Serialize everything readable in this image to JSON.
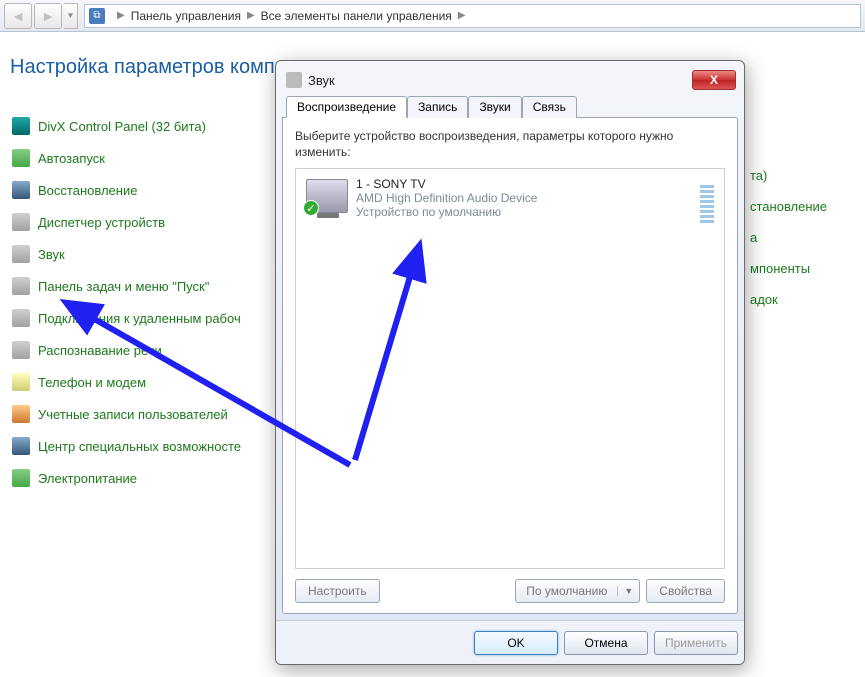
{
  "breadcrumb": {
    "item1": "Панель управления",
    "item2": "Все элементы панели управления"
  },
  "page": {
    "title": "Настройка параметров комп"
  },
  "cp_items": [
    {
      "label": "DivX Control Panel (32 бита)",
      "icon": "ic-teal"
    },
    {
      "label": "Автозапуск",
      "icon": "ic-green"
    },
    {
      "label": "Восстановление",
      "icon": "ic-blue"
    },
    {
      "label": "Диспетчер устройств",
      "icon": "ic-generic"
    },
    {
      "label": "Звук",
      "icon": "ic-generic"
    },
    {
      "label": "Панель задач и меню \"Пуск\"",
      "icon": "ic-generic"
    },
    {
      "label": "Подключения к удаленным рабоч",
      "icon": "ic-generic"
    },
    {
      "label": "Распознавание речи",
      "icon": "ic-generic"
    },
    {
      "label": "Телефон и модем",
      "icon": "ic-yellow"
    },
    {
      "label": "Учетные записи пользователей",
      "icon": "ic-orange"
    },
    {
      "label": "Центр специальных возможносте",
      "icon": "ic-blue"
    },
    {
      "label": "Электропитание",
      "icon": "ic-green"
    }
  ],
  "right_links": [
    "та)",
    "становление",
    "а",
    "мпоненты",
    "адок"
  ],
  "dialog": {
    "title": "Звук",
    "tabs": [
      "Воспроизведение",
      "Запись",
      "Звуки",
      "Связь"
    ],
    "active_tab": 0,
    "instruction": "Выберите устройство воспроизведения, параметры которого нужно изменить:",
    "device": {
      "name": "1 - SONY TV",
      "driver": "AMD High Definition Audio Device",
      "status": "Устройство по умолчанию"
    },
    "buttons": {
      "configure": "Настроить",
      "default": "По умолчанию",
      "properties": "Свойства"
    },
    "bottom": {
      "ok": "OK",
      "cancel": "Отмена",
      "apply": "Применить"
    }
  }
}
